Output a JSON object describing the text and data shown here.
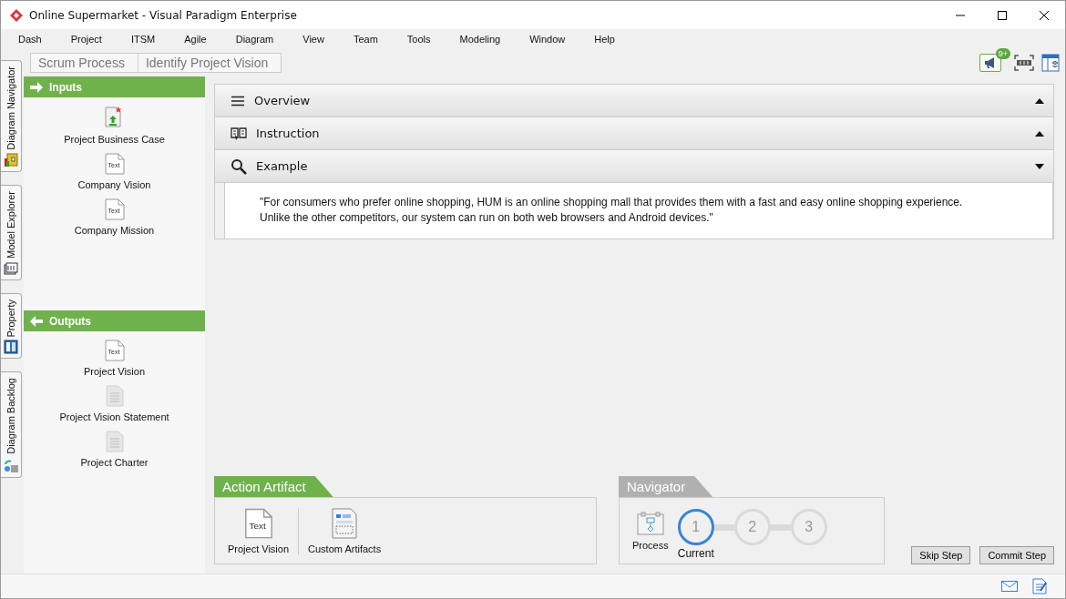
{
  "window": {
    "title": "Online Supermarket - Visual Paradigm Enterprise"
  },
  "menu": [
    "Dash",
    "Project",
    "ITSM",
    "Agile",
    "Diagram",
    "View",
    "Team",
    "Tools",
    "Modeling",
    "Window",
    "Help"
  ],
  "side_tabs": [
    {
      "label": "Diagram Navigator",
      "kind": "navigator"
    },
    {
      "label": "Model Explorer",
      "kind": "explorer"
    },
    {
      "label": "Property",
      "kind": "property"
    },
    {
      "label": "Diagram Backlog",
      "kind": "backlog"
    }
  ],
  "breadcrumb": [
    "Scrum Process",
    "Identify Project Vision"
  ],
  "notification_badge": "9+",
  "inputs": {
    "title": "Inputs",
    "items": [
      {
        "label": "Project Business Case",
        "kind": "upload"
      },
      {
        "label": "Company Vision",
        "kind": "text",
        "icon_text": "Text"
      },
      {
        "label": "Company Mission",
        "kind": "text",
        "icon_text": "Text"
      }
    ]
  },
  "outputs": {
    "title": "Outputs",
    "items": [
      {
        "label": "Project Vision",
        "kind": "text",
        "icon_text": "Text"
      },
      {
        "label": "Project Vision Statement",
        "kind": "doc"
      },
      {
        "label": "Project Charter",
        "kind": "doc"
      }
    ]
  },
  "sections": [
    {
      "title": "Overview",
      "kind": "overview",
      "expanded": false
    },
    {
      "title": "Instruction",
      "kind": "instruction",
      "expanded": false
    },
    {
      "title": "Example",
      "kind": "example",
      "expanded": true,
      "content": "\"For consumers who prefer online shopping, HUM is an online shopping mall that provides them with a fast and easy online shopping experience.\nUnlike the other competitors, our system can run on both web browsers and Android devices.\""
    }
  ],
  "action_artifact": {
    "title": "Action Artifact",
    "items": [
      {
        "label": "Project Vision",
        "kind": "text",
        "icon_text": "Text"
      },
      {
        "label": "Custom Artifacts",
        "kind": "custom"
      }
    ]
  },
  "navigator": {
    "title": "Navigator",
    "process_label": "Process",
    "current_label": "Current",
    "steps": [
      {
        "number": "1",
        "selected": true
      },
      {
        "number": "2",
        "selected": false
      },
      {
        "number": "3",
        "selected": false
      }
    ]
  },
  "buttons": [
    "Skip Step",
    "Commit Step"
  ]
}
